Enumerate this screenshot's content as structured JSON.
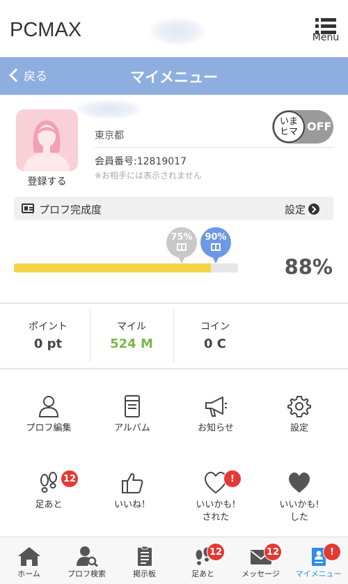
{
  "header": {
    "logo": "PCMAX",
    "menu_label": "Menu"
  },
  "titlebar": {
    "back_label": "戻る",
    "title": "マイメニュー"
  },
  "profile": {
    "avatar_label": "登録する",
    "prefecture": "東京都",
    "member_number": "会員番号:12819017",
    "note": "※お相手には表示されません",
    "toggle_knob_line1": "いま",
    "toggle_knob_line2": "ヒマ",
    "toggle_state": "OFF",
    "completion_title": "プロフ完成度",
    "completion_settings": "設定",
    "milestone_75": "75%",
    "milestone_90": "90%",
    "completion_percent": "88%",
    "completion_value": 0.88
  },
  "stats": [
    {
      "label": "ポイント",
      "value": "0 pt"
    },
    {
      "label": "マイル",
      "value": "524 M"
    },
    {
      "label": "コイン",
      "value": "0 C"
    }
  ],
  "grid": [
    {
      "label": "プロフ編集",
      "icon": "person-icon"
    },
    {
      "label": "アルバム",
      "icon": "album-icon"
    },
    {
      "label": "お知らせ",
      "icon": "megaphone-icon"
    },
    {
      "label": "設定",
      "icon": "gear-icon"
    },
    {
      "label": "足あと",
      "icon": "footprints-icon",
      "badge": "12"
    },
    {
      "label": "いいね！",
      "icon": "thumbs-up-icon"
    },
    {
      "label": "いいかも!\nされた",
      "line1": "いいかも!",
      "line2": "された",
      "icon": "heart-outline-icon",
      "badge": "!"
    },
    {
      "label": "いいかも!\nした",
      "line1": "いいかも!",
      "line2": "した",
      "icon": "heart-filled-icon"
    }
  ],
  "bottom_nav": [
    {
      "label": "ホーム",
      "icon": "home-icon"
    },
    {
      "label": "プロフ検索",
      "icon": "profile-search-icon"
    },
    {
      "label": "掲示板",
      "icon": "board-icon"
    },
    {
      "label": "足あと",
      "icon": "footprints-icon",
      "badge": "12"
    },
    {
      "label": "メッセージ",
      "icon": "mail-icon",
      "badge": "12"
    },
    {
      "label": "マイメニュー",
      "icon": "my-menu-icon",
      "badge": "!",
      "active": true
    }
  ],
  "colors": {
    "titlebar": "#8eaee0",
    "progress_fill": "#f5d547",
    "milestone_75": "#c8c8c8",
    "milestone_90": "#6e98e6",
    "miles_value": "#7ab648",
    "badge": "#e53935",
    "active_nav": "#2b8de8"
  }
}
